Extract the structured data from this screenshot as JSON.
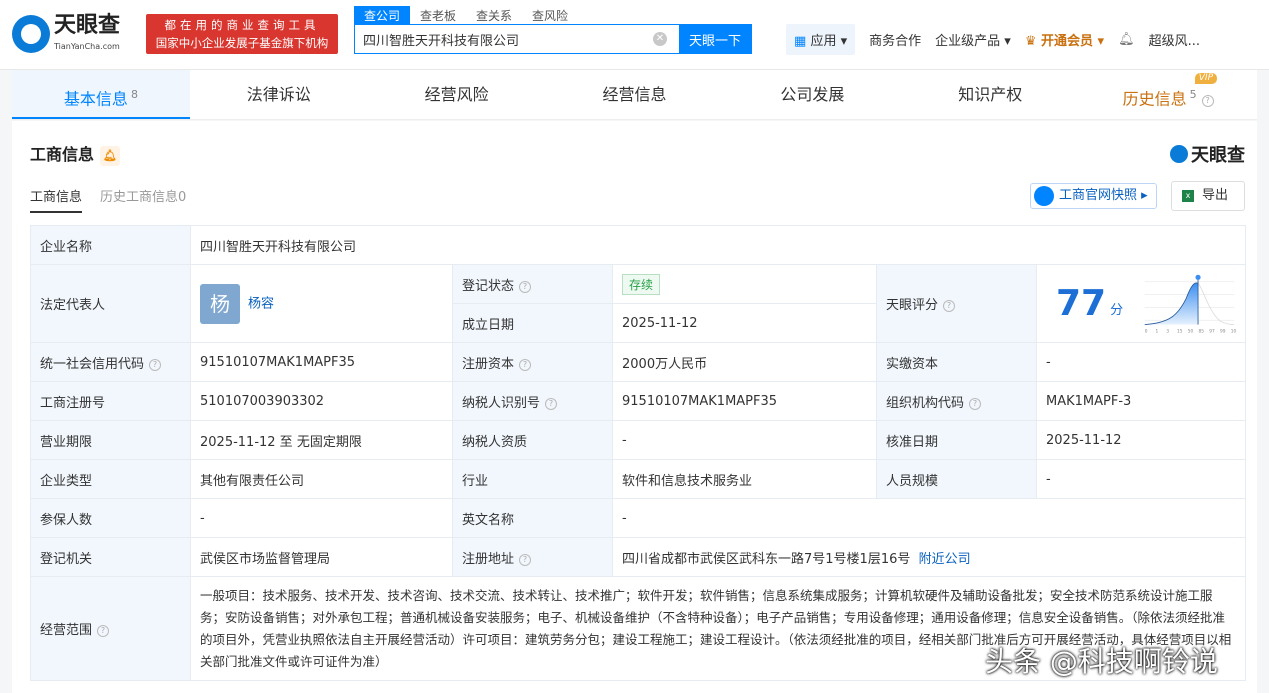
{
  "header": {
    "logo_text": "天眼查",
    "logo_domain": "TianYanCha.com",
    "slogan_line1": "都在用的商业查询工具",
    "slogan_line2": "国家中小企业发展子基金旗下机构",
    "search_tabs": [
      "查公司",
      "查老板",
      "查关系",
      "查风险"
    ],
    "search_value": "四川智胜天开科技有限公司",
    "search_button": "天眼一下",
    "nav": {
      "apps": "应用",
      "biz": "商务合作",
      "enterprise": "企业级产品",
      "vip": "开通会员",
      "user": "超级风..."
    }
  },
  "tabs": [
    {
      "label": "基本信息",
      "count": "8"
    },
    {
      "label": "法律诉讼"
    },
    {
      "label": "经营风险"
    },
    {
      "label": "经营信息"
    },
    {
      "label": "公司发展"
    },
    {
      "label": "知识产权"
    },
    {
      "label": "历史信息",
      "count": "5",
      "badge": "VIP"
    }
  ],
  "section": {
    "title": "工商信息",
    "brand": "天眼查",
    "subtabs": [
      "工商信息",
      "历史工商信息0"
    ],
    "snapshot_button": "工商官网快照",
    "export_button": "导出"
  },
  "info": {
    "company_name_label": "企业名称",
    "company_name": "四川智胜天开科技有限公司",
    "legal_rep_label": "法定代表人",
    "legal_rep_avatar": "杨",
    "legal_rep": "杨容",
    "status_label": "登记状态",
    "status": "存续",
    "established_label": "成立日期",
    "established": "2025-11-12",
    "score_label": "天眼评分",
    "score": "77",
    "score_unit": "分",
    "score_ticks": [
      "0",
      "1",
      "3",
      "15",
      "50",
      "85",
      "97",
      "99",
      "100"
    ],
    "credit_code_label": "统一社会信用代码",
    "credit_code": "91510107MAK1MAPF35",
    "reg_capital_label": "注册资本",
    "reg_capital": "2000万人民币",
    "paid_capital_label": "实缴资本",
    "paid_capital": "-",
    "reg_no_label": "工商注册号",
    "reg_no": "510107003903302",
    "taxpayer_id_label": "纳税人识别号",
    "taxpayer_id": "91510107MAK1MAPF35",
    "org_code_label": "组织机构代码",
    "org_code": "MAK1MAPF-3",
    "term_label": "营业期限",
    "term": "2025-11-12 至 无固定期限",
    "taxpayer_qual_label": "纳税人资质",
    "taxpayer_qual": "-",
    "approved_label": "核准日期",
    "approved": "2025-11-12",
    "type_label": "企业类型",
    "type": "其他有限责任公司",
    "industry_label": "行业",
    "industry": "软件和信息技术服务业",
    "staff_label": "人员规模",
    "staff": "-",
    "insured_label": "参保人数",
    "insured": "-",
    "en_name_label": "英文名称",
    "en_name": "-",
    "authority_label": "登记机关",
    "authority": "武侯区市场监督管理局",
    "address_label": "注册地址",
    "address": "四川省成都市武侯区武科东一路7号1号楼1层16号",
    "nearby": "附近公司",
    "scope_label": "经营范围",
    "scope": "一般项目：技术服务、技术开发、技术咨询、技术交流、技术转让、技术推广；软件开发；软件销售；信息系统集成服务；计算机软硬件及辅助设备批发；安全技术防范系统设计施工服务；安防设备销售；对外承包工程；普通机械设备安装服务；电子、机械设备维护（不含特种设备）；电子产品销售；专用设备修理；通用设备修理；信息安全设备销售。（除依法须经批准的项目外，凭营业执照依法自主开展经营活动）许可项目：建筑劳务分包；建设工程施工；建设工程设计。（依法须经批准的项目，经相关部门批准后方可开展经营活动，具体经营项目以相关部门批准文件或许可证件为准）"
  },
  "watermark": "头条 @科技啊铃说"
}
